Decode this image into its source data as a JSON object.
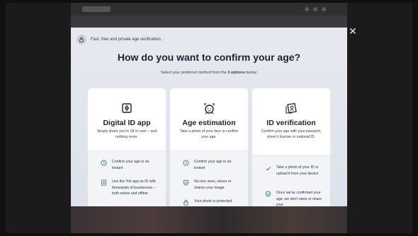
{
  "modal": {
    "top_text": "Fast, free and private age verification.",
    "title": "How do you want to confirm your age?",
    "subtitle_pre": "Select your preferred method from the ",
    "subtitle_bold": "3 options",
    "subtitle_post": " below:",
    "close_label": "✕"
  },
  "cards": [
    {
      "title": "Digital ID app",
      "desc": "Simply share you're 18 or over – and nothing more.",
      "features": [
        {
          "icon": "clock-icon",
          "text": "Confirm your age in an instant"
        },
        {
          "icon": "phone-id-icon",
          "text": "Use the Yoti app as ID with thousands of businesses – both online and offline"
        }
      ]
    },
    {
      "title": "Age estimation",
      "desc": "Take a photo of your face to confirm your age.",
      "features": [
        {
          "icon": "clock-icon",
          "text": "Confirm your age in an instant"
        },
        {
          "icon": "shield-check-icon",
          "text": "No-one sees, stores or shares your image"
        },
        {
          "icon": "lock-icon",
          "text": "Your photo is protected"
        }
      ]
    },
    {
      "title": "ID verification",
      "desc": "Confirm your age with your passport, driver's license or national ID.",
      "features": [
        {
          "icon": "check-icon",
          "text": "Take a photo of your ID or upload it from your device"
        },
        {
          "icon": "shield-check-icon",
          "text": "Once we've confirmed your age, we don't store or share your"
        }
      ]
    }
  ],
  "colors": {
    "accent": "#2d6a5a",
    "title": "#1c2230"
  }
}
